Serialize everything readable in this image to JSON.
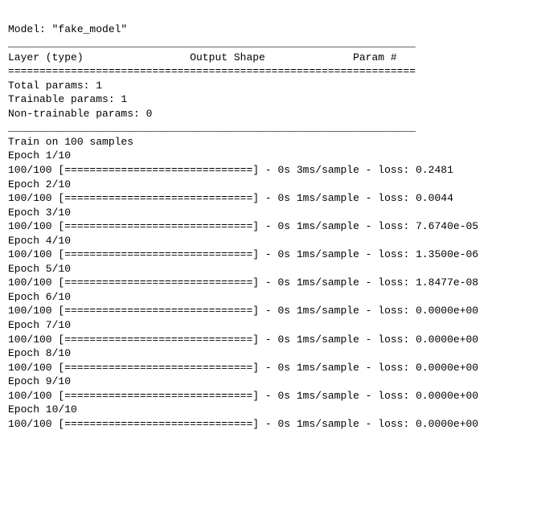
{
  "model_line": "Model: \"fake_model\"",
  "rules": {
    "underscore": "_________________________________________________________________",
    "equals": "================================================================="
  },
  "header_row": "Layer (type)                 Output Shape              Param #   ",
  "params": {
    "total": "Total params: 1",
    "trainable": "Trainable params: 1",
    "non_trainable": "Non-trainable params: 0"
  },
  "training": {
    "train_on": "Train on 100 samples",
    "epochs": [
      {
        "label": "Epoch 1/10",
        "progress": "100/100 [==============================] - 0s 3ms/sample - loss: 0.2481"
      },
      {
        "label": "Epoch 2/10",
        "progress": "100/100 [==============================] - 0s 1ms/sample - loss: 0.0044"
      },
      {
        "label": "Epoch 3/10",
        "progress": "100/100 [==============================] - 0s 1ms/sample - loss: 7.6740e-05"
      },
      {
        "label": "Epoch 4/10",
        "progress": "100/100 [==============================] - 0s 1ms/sample - loss: 1.3500e-06"
      },
      {
        "label": "Epoch 5/10",
        "progress": "100/100 [==============================] - 0s 1ms/sample - loss: 1.8477e-08"
      },
      {
        "label": "Epoch 6/10",
        "progress": "100/100 [==============================] - 0s 1ms/sample - loss: 0.0000e+00"
      },
      {
        "label": "Epoch 7/10",
        "progress": "100/100 [==============================] - 0s 1ms/sample - loss: 0.0000e+00"
      },
      {
        "label": "Epoch 8/10",
        "progress": "100/100 [==============================] - 0s 1ms/sample - loss: 0.0000e+00"
      },
      {
        "label": "Epoch 9/10",
        "progress": "100/100 [==============================] - 0s 1ms/sample - loss: 0.0000e+00"
      },
      {
        "label": "Epoch 10/10",
        "progress": "100/100 [==============================] - 0s 1ms/sample - loss: 0.0000e+00"
      }
    ]
  }
}
